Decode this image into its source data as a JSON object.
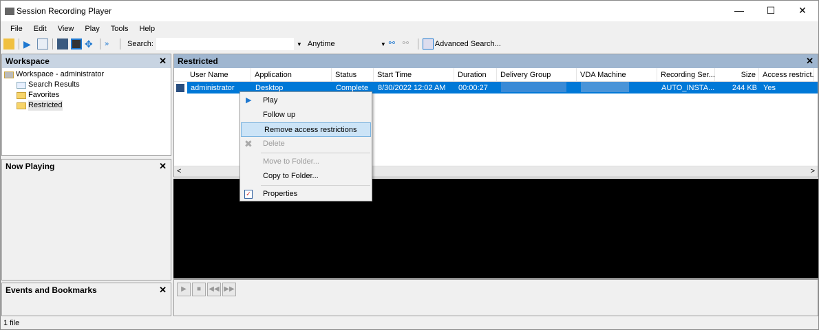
{
  "window": {
    "title": "Session Recording Player",
    "minimize": "—",
    "maximize": "☐",
    "close": "✕"
  },
  "menu": [
    "File",
    "Edit",
    "View",
    "Play",
    "Tools",
    "Help"
  ],
  "toolbar": {
    "search_label": "Search:",
    "search_value": "",
    "time_filter": "Anytime",
    "advanced_search": "Advanced Search..."
  },
  "workspace": {
    "title": "Workspace",
    "close": "✕",
    "root": "Workspace - administrator",
    "items": [
      "Search Results",
      "Favorites",
      "Restricted"
    ]
  },
  "now_playing": {
    "title": "Now Playing",
    "close": "✕"
  },
  "events": {
    "title": "Events and Bookmarks",
    "close": "✕"
  },
  "restricted": {
    "title": "Restricted",
    "close": "✕",
    "columns": [
      "User Name",
      "Application",
      "Status",
      "Start Time",
      "Duration",
      "Delivery Group",
      "VDA Machine",
      "Recording Ser...",
      "Size",
      "Access restrict..."
    ],
    "rows": [
      [
        "administrator",
        "Desktop",
        "Complete",
        "8/30/2022 12:02 AM",
        "00:00:27",
        "",
        "",
        "AUTO_INSTA...",
        "244 KB",
        "Yes"
      ]
    ]
  },
  "context_menu": [
    "Play",
    "Follow up",
    "Remove access restrictions",
    "Delete",
    "Move to Folder...",
    "Copy to Folder...",
    "Properties"
  ],
  "status": "1 file",
  "colors": {
    "selection": "#0078d7",
    "panel_header": "#c8d4e2",
    "restricted_header": "#9fb6d0",
    "highlight": "#cce4f7"
  }
}
